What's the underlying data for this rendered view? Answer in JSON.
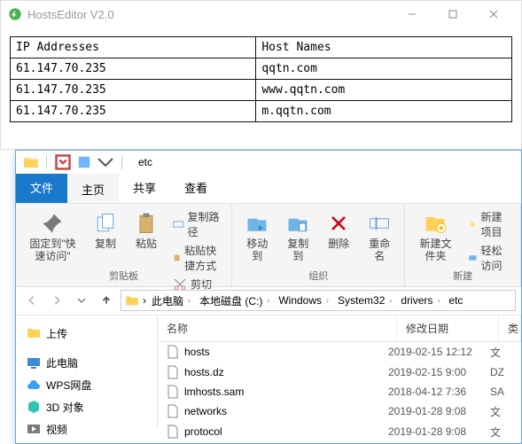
{
  "hosts_editor": {
    "title": "HostsEditor V2.0",
    "columns": {
      "ip": "IP Addresses",
      "host": "Host Names"
    },
    "rows": [
      {
        "ip": "61.147.70.235",
        "host": "qqtn.com"
      },
      {
        "ip": "61.147.70.235",
        "host": "www.qqtn.com"
      },
      {
        "ip": "61.147.70.235",
        "host": "m.qqtn.com"
      }
    ]
  },
  "explorer": {
    "window_title": "etc",
    "tabs": {
      "file": "文件",
      "home": "主页",
      "share": "共享",
      "view": "查看"
    },
    "ribbon": {
      "pin": "固定到\"快速访问\"",
      "copy": "复制",
      "paste": "粘贴",
      "cut": "剪切",
      "copy_path": "复制路径",
      "paste_shortcut": "粘贴快捷方式",
      "clipboard": "剪贴板",
      "move_to": "移动到",
      "copy_to": "复制到",
      "delete": "删除",
      "rename": "重命名",
      "organize": "组织",
      "new_folder": "新建文件夹",
      "new_item": "新建项目",
      "easy_access": "轻松访问",
      "new_group": "新建"
    },
    "breadcrumb": [
      "此电脑",
      "本地磁盘 (C:)",
      "Windows",
      "System32",
      "drivers",
      "etc"
    ],
    "sidebar": {
      "upload": "上传",
      "this_pc": "此电脑",
      "wps": "WPS网盘",
      "objects3d": "3D 对象",
      "videos": "视频"
    },
    "columns": {
      "name": "名称",
      "modified": "修改日期",
      "type": "类"
    },
    "files": [
      {
        "name": "hosts",
        "modified": "2019-02-15 12:12",
        "type": "文"
      },
      {
        "name": "hosts.dz",
        "modified": "2019-02-15 9:00",
        "type": "DZ"
      },
      {
        "name": "lmhosts.sam",
        "modified": "2018-04-12 7:36",
        "type": "SA"
      },
      {
        "name": "networks",
        "modified": "2019-01-28 9:08",
        "type": "文"
      },
      {
        "name": "protocol",
        "modified": "2019-01-28 9:08",
        "type": "文"
      }
    ]
  }
}
